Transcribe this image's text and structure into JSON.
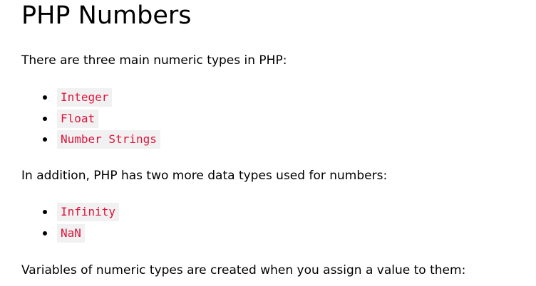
{
  "title": "PHP Numbers",
  "intro": "There are three main numeric types in PHP:",
  "main_types": [
    "Integer",
    "Float",
    "Number Strings"
  ],
  "addition": "In addition, PHP has two more data types used for numbers:",
  "extra_types": [
    "Infinity",
    "NaN"
  ],
  "closing": "Variables of numeric types are created when you assign a value to them:",
  "colors": {
    "code_text": "#dc143c",
    "code_background": "#f1f1f1"
  }
}
